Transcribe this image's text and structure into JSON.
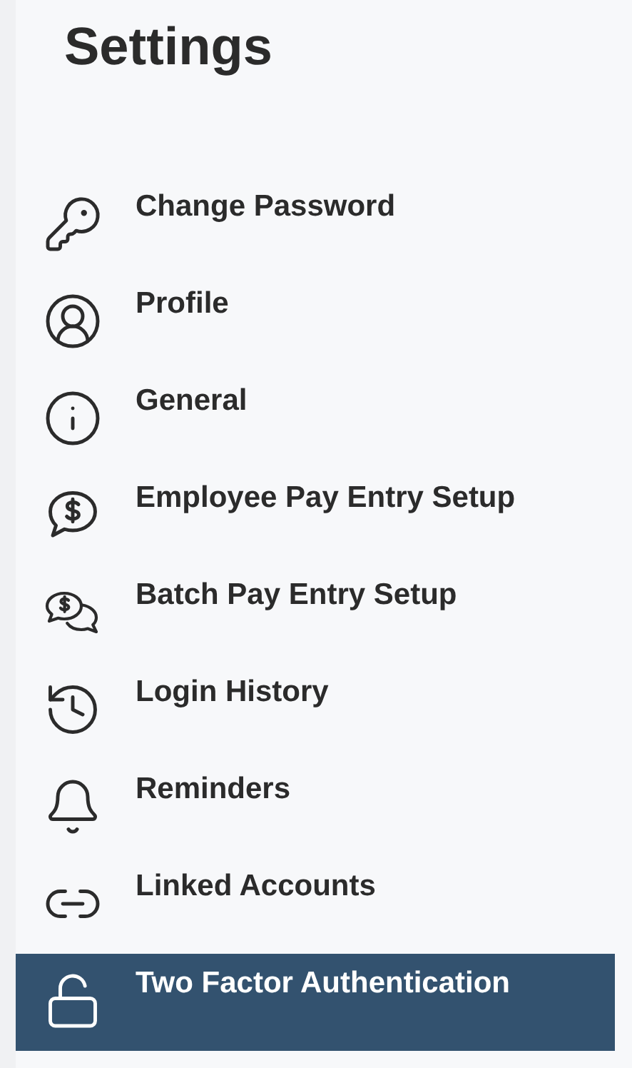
{
  "title": "Settings",
  "menu": [
    {
      "label": "Change Password",
      "selected": false
    },
    {
      "label": "Profile",
      "selected": false
    },
    {
      "label": "General",
      "selected": false
    },
    {
      "label": "Employee Pay Entry Setup",
      "selected": false
    },
    {
      "label": "Batch Pay Entry Setup",
      "selected": false
    },
    {
      "label": "Login History",
      "selected": false
    },
    {
      "label": "Reminders",
      "selected": false
    },
    {
      "label": "Linked Accounts",
      "selected": false
    },
    {
      "label": "Two Factor Authentication",
      "selected": true
    }
  ]
}
